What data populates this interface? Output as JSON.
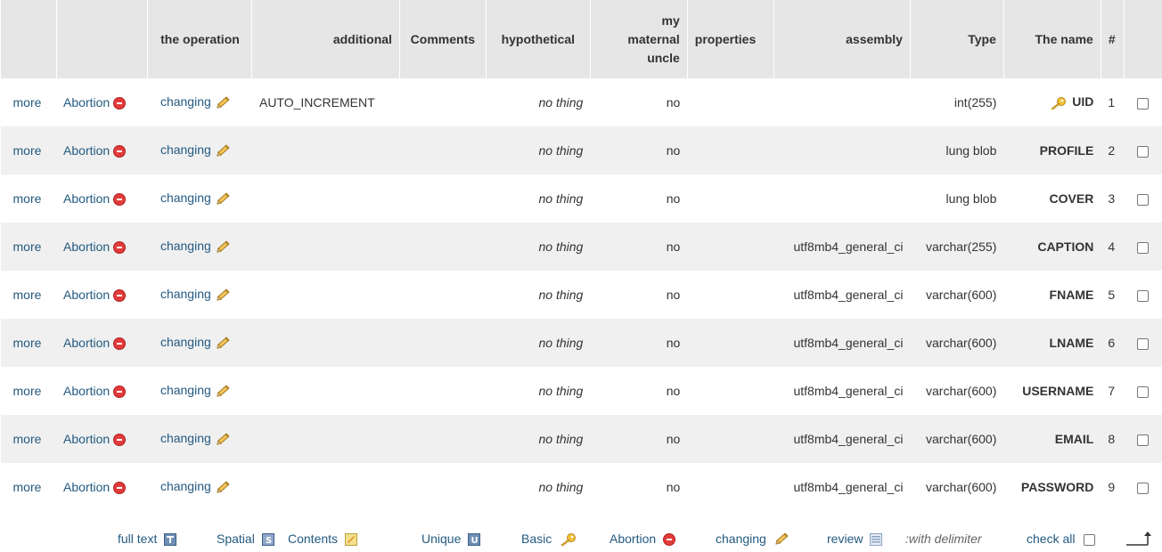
{
  "headers": {
    "operation": "the operation",
    "additional": "additional",
    "comments": "Comments",
    "hypothetical": "hypothetical",
    "uncle_1": "my",
    "uncle_2": "maternal",
    "uncle_3": "uncle",
    "properties": "properties",
    "assembly": "assembly",
    "type": "Type",
    "name": "The name",
    "num": "#"
  },
  "row_actions": {
    "more": "more",
    "abortion": "Abortion",
    "changing": "changing"
  },
  "rows": [
    {
      "num": "1",
      "name": "UID",
      "type": "int(255)",
      "assembly": "",
      "properties": "",
      "null": "no",
      "default": "no thing",
      "comments": "",
      "extra": "AUTO_INCREMENT",
      "primary_key": true
    },
    {
      "num": "2",
      "name": "PROFILE",
      "type": "lung blob",
      "assembly": "",
      "properties": "",
      "null": "no",
      "default": "no thing",
      "comments": "",
      "extra": "",
      "primary_key": false
    },
    {
      "num": "3",
      "name": "COVER",
      "type": "lung blob",
      "assembly": "",
      "properties": "",
      "null": "no",
      "default": "no thing",
      "comments": "",
      "extra": "",
      "primary_key": false
    },
    {
      "num": "4",
      "name": "CAPTION",
      "type": "varchar(255)",
      "assembly": "utf8mb4_general_ci",
      "properties": "",
      "null": "no",
      "default": "no thing",
      "comments": "",
      "extra": "",
      "primary_key": false
    },
    {
      "num": "5",
      "name": "FNAME",
      "type": "varchar(600)",
      "assembly": "utf8mb4_general_ci",
      "properties": "",
      "null": "no",
      "default": "no thing",
      "comments": "",
      "extra": "",
      "primary_key": false
    },
    {
      "num": "6",
      "name": "LNAME",
      "type": "varchar(600)",
      "assembly": "utf8mb4_general_ci",
      "properties": "",
      "null": "no",
      "default": "no thing",
      "comments": "",
      "extra": "",
      "primary_key": false
    },
    {
      "num": "7",
      "name": "USERNAME",
      "type": "varchar(600)",
      "assembly": "utf8mb4_general_ci",
      "properties": "",
      "null": "no",
      "default": "no thing",
      "comments": "",
      "extra": "",
      "primary_key": false
    },
    {
      "num": "8",
      "name": "EMAIL",
      "type": "varchar(600)",
      "assembly": "utf8mb4_general_ci",
      "properties": "",
      "null": "no",
      "default": "no thing",
      "comments": "",
      "extra": "",
      "primary_key": false
    },
    {
      "num": "9",
      "name": "PASSWORD",
      "type": "varchar(600)",
      "assembly": "utf8mb4_general_ci",
      "properties": "",
      "null": "no",
      "default": "no thing",
      "comments": "",
      "extra": "",
      "primary_key": false
    }
  ],
  "footer": {
    "full_text": "full text",
    "spatial": "Spatial",
    "contents": "Contents",
    "unique": "Unique",
    "basic": "Basic",
    "abortion": "Abortion",
    "changing": "changing",
    "review": "review",
    "with_delimiter": ":with delimiter",
    "check_all": "check all"
  },
  "icons": {
    "drop": "minus-circle-icon",
    "edit": "pencil-icon",
    "primary": "key-icon",
    "fulltext": "fulltext-index-icon",
    "spatial": "spatial-index-icon",
    "index": "index-icon",
    "unique": "unique-index-icon",
    "review": "browse-icon",
    "up": "arrow-up-icon"
  },
  "colors": {
    "header_bg": "#e6e6e6",
    "row_even": "#f0f0f0",
    "row_odd": "#ffffff",
    "link": "#235a81",
    "drop_red": "#e23b3b"
  }
}
